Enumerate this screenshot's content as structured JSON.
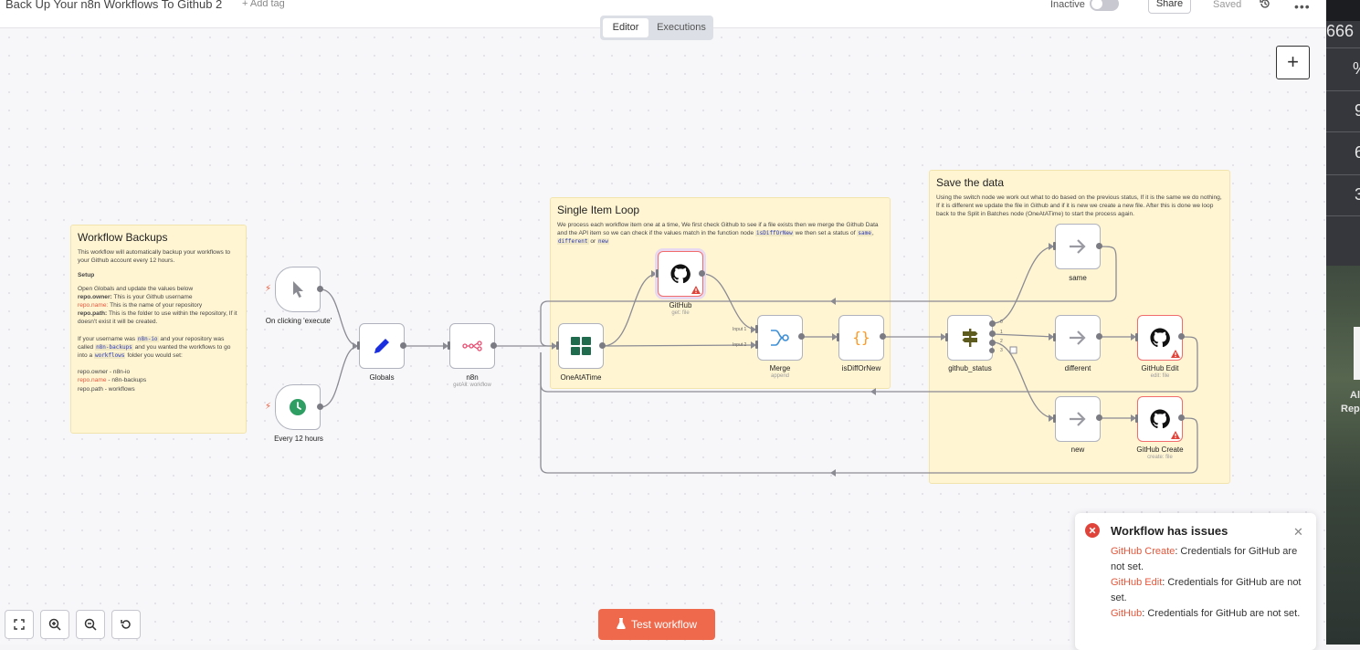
{
  "header": {
    "workflow_title": "Back Up Your n8n Workflows To Github 2",
    "add_tag": "+ Add tag",
    "status_label": "Inactive",
    "share_label": "Share",
    "saved_label": "Saved",
    "history_icon": "history-icon",
    "more_icon": "more-icon"
  },
  "tabs": {
    "editor": "Editor",
    "executions": "Executions"
  },
  "canvas_add_button": "+",
  "stickies": {
    "workflow_backups": {
      "title": "Workflow Backups",
      "intro": "This workflow will automatically backup your workflows to your Github account every 12 hours.",
      "setup_heading": "Setup",
      "setup_line": "Open Globals and update the values below",
      "owner_key": "repo.owner:",
      "owner_desc": " This is your Github username",
      "name_key": "repo.name:",
      "name_desc": " This is the name of your repository",
      "path_key": "repo.path:",
      "path_desc": " This is the folder to use within the repository, If it doesn't exist it will be created.",
      "example_a": "If your username was ",
      "example_user": "n8n-io",
      "example_b": " and your repository was called ",
      "example_repo": "n8n-backups",
      "example_c": " and you wanted the workflows to go into a ",
      "example_folder": "workflows",
      "example_d": " folder you would set:",
      "val_owner": "repo.owner - n8n-io",
      "val_name_key": "repo.name",
      "val_name": " - n8n-backups",
      "val_path": "repo.path - workflows"
    },
    "single_item_loop": {
      "title": "Single Item Loop",
      "text_a": "We process each workflow item one at a time, We first check Github to see if a file exists then we merge the Github Data and the API item so we can check if the values match in the function node ",
      "code_fn": "isDiffOrNew",
      "text_b": " we then set a status of ",
      "code_same": "same",
      "sep1": ", ",
      "code_diff": "different",
      "sep2": " or ",
      "code_new": "new"
    },
    "save_the_data": {
      "title": "Save the data",
      "text": "Using the switch node we work out what to do based on the previous status, If it is the same we do nothing, If it is different we update the file in Github and if it is new we create a new file. After this is done we loop back to the Split in Batches node (OneAtATime) to start the process again."
    }
  },
  "nodes": {
    "manual": {
      "label": "On clicking 'execute'",
      "icon": "pointer-icon"
    },
    "schedule": {
      "label": "Every 12 hours",
      "icon": "clock-icon"
    },
    "globals": {
      "label": "Globals",
      "icon": "pencil-icon"
    },
    "n8n": {
      "label": "n8n",
      "sublabel": "getAll: workflow",
      "icon": "n8n-logo-icon"
    },
    "one_at_a_time": {
      "label": "OneAtATime",
      "icon": "grid-icon"
    },
    "github_get": {
      "label": "GitHub",
      "sublabel": "get: file",
      "icon": "github-icon"
    },
    "merge": {
      "label": "Merge",
      "sublabel": "append",
      "icon": "merge-icon",
      "port1": "Input 1",
      "port2": "Input 2"
    },
    "is_diff_or_new": {
      "label": "isDiffOrNew",
      "icon": "code-icon"
    },
    "github_status": {
      "label": "github_status",
      "icon": "signpost-icon",
      "ports": [
        "0",
        "1",
        "2",
        "3"
      ]
    },
    "same": {
      "label": "same",
      "icon": "arrow-right-icon"
    },
    "different": {
      "label": "different",
      "icon": "arrow-right-icon"
    },
    "new": {
      "label": "new",
      "icon": "arrow-right-icon"
    },
    "github_edit": {
      "label": "GitHub Edit",
      "sublabel": "edit: file",
      "icon": "github-icon"
    },
    "github_create": {
      "label": "GitHub Create",
      "sublabel": "create: file",
      "icon": "github-icon"
    }
  },
  "controls": {
    "fit_icon": "fit-view-icon",
    "zoom_in_icon": "zoom-in-icon",
    "zoom_out_icon": "zoom-out-icon",
    "reset_icon": "reset-icon"
  },
  "test_button": {
    "label": "Test workflow",
    "icon": "flask-icon"
  },
  "toast": {
    "title": "Workflow has issues",
    "items": [
      {
        "node": "GitHub Create",
        "message": ": Credentials for GitHub are not set."
      },
      {
        "node": "GitHub Edit",
        "message": ": Credentials for GitHub are not set."
      },
      {
        "node": "GitHub",
        "message": ": Credentials for GitHub are not set."
      }
    ]
  },
  "background_window": {
    "text_1": "666",
    "text_2": "%",
    "text_3": "9",
    "text_4": "6",
    "text_5": "3",
    "text_6": "Al",
    "text_7": "Rep"
  },
  "colors": {
    "accent": "#ef6a4d",
    "error": "#e0433a",
    "sticky": "#fff5d3",
    "link_red": "#e4573c",
    "schedule_green": "#31c48d",
    "globals_blue": "#1a2fe0",
    "grid_green": "#1f7a54"
  }
}
